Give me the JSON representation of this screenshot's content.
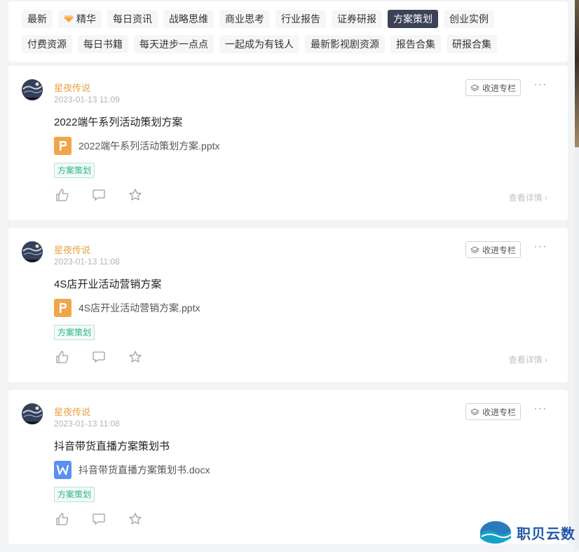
{
  "tabs": {
    "row1": [
      "最新",
      "精华",
      "每日资讯",
      "战略思维",
      "商业思考",
      "行业报告",
      "证券研报",
      "方案策划",
      "创业实例"
    ],
    "row2": [
      "付费资源",
      "每日书籍",
      "每天进步一点点",
      "一起成为有钱人",
      "最新影视剧资源",
      "报告合集",
      "研报合集"
    ],
    "active": "方案策划"
  },
  "common": {
    "collect_label": "收进专栏",
    "details_label": "查看详情",
    "more_label": "···"
  },
  "posts": [
    {
      "author": "星夜传说",
      "time": "2023-01-13 11:09",
      "title": "2022端午系列活动策划方案",
      "file_name": "2022端午系列活动策划方案.pptx",
      "file_type": "pptx",
      "tag": "方案策划"
    },
    {
      "author": "星夜传说",
      "time": "2023-01-13 11:08",
      "title": "4S店开业活动营销方案",
      "file_name": "4S店开业活动营销方案.pptx",
      "file_type": "pptx",
      "tag": "方案策划"
    },
    {
      "author": "星夜传说",
      "time": "2023-01-13 11:08",
      "title": "抖音带货直播方案策划书",
      "file_name": "抖音带货直播方案策划书.docx",
      "file_type": "docx",
      "tag": "方案策划"
    }
  ],
  "watermark": {
    "text": "职贝云数"
  },
  "icons": {
    "gem": "gem-icon",
    "collect": "collect-icon",
    "like": "thumbs-up-icon",
    "comment": "comment-icon",
    "star": "star-icon",
    "chevron": "chevron-right-icon"
  },
  "colors": {
    "active_tab_bg": "#3c4258",
    "author": "#e8a13c",
    "tag": "#2db38a",
    "ppt": "#f0a54a",
    "doc": "#5b8ff2",
    "watermark": "#1f57a8"
  }
}
